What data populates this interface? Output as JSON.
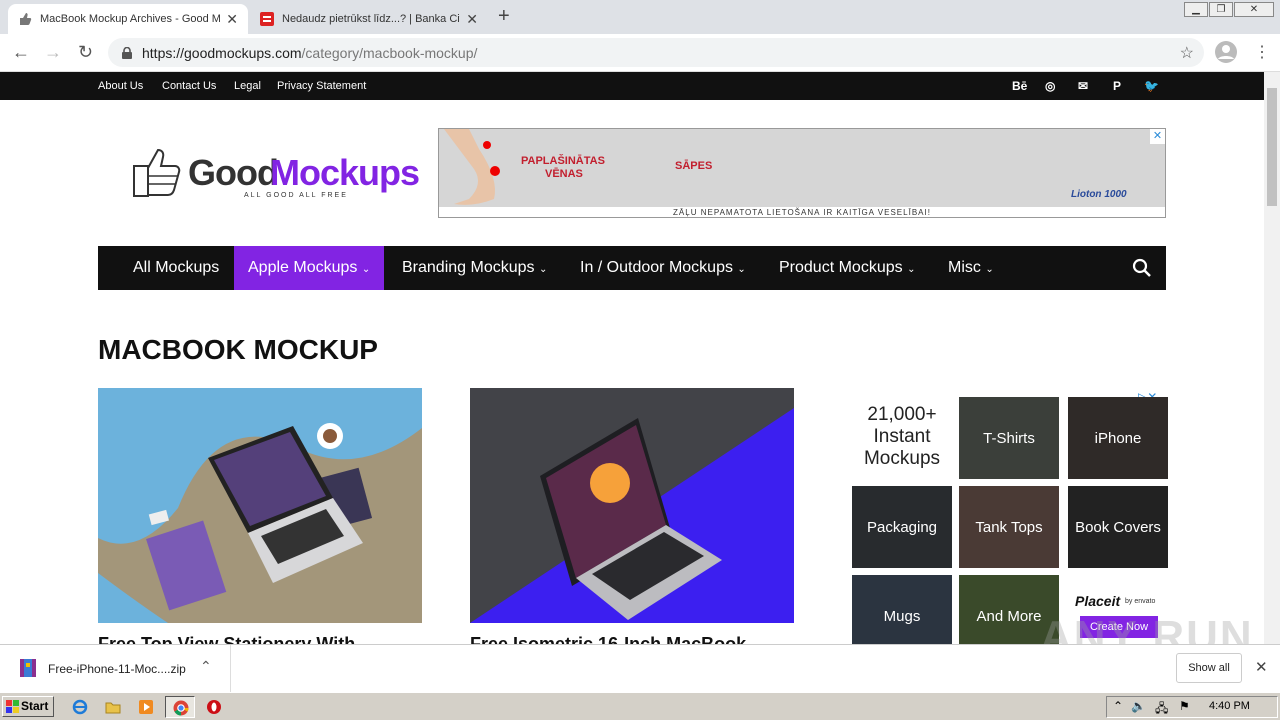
{
  "tabs": [
    {
      "title": "MacBook Mockup Archives - Good Mo",
      "close": "✕"
    },
    {
      "title": "Nedaudz pietrūkst līdz...? | Banka Cit",
      "close": "✕"
    }
  ],
  "new_tab": "+",
  "url": {
    "domain": "https://goodmockups.com",
    "path": "/category/macbook-mockup/"
  },
  "top_links": [
    "About Us",
    "Contact Us",
    "Legal",
    "Privacy Statement"
  ],
  "social": [
    "Bē",
    "◎",
    "✉",
    "P",
    "🐦"
  ],
  "logo": {
    "part1": "Good",
    "part2": "Mockups",
    "tagline": "ALL GOOD ALL FREE"
  },
  "ad": {
    "text1": "PAPLAŠINĀTAS",
    "text2": "VĒNAS",
    "text3": "SĀPES",
    "brand": "Lioton 1000",
    "footer": "ZĀĻU NEPAMATOTA LIETOŠANA IR KAITĪGA VESELĪBAI!"
  },
  "nav": [
    "All Mockups",
    "Apple Mockups",
    "Branding Mockups",
    "In / Outdoor Mockups",
    "Product Mockups",
    "Misc"
  ],
  "page_title": "MACBOOK MOCKUP",
  "posts": [
    "Free Top View Stationery With",
    "Free Isometric 16-Inch MacBook"
  ],
  "sidead": {
    "head": "21,000+ Instant Mockups",
    "tiles": [
      "T-Shirts",
      "iPhone",
      "Packaging",
      "Tank Tops",
      "Book Covers",
      "Mugs",
      "And More"
    ],
    "brand": "Placeit",
    "brand_by": "by envato",
    "cta": "Create Now"
  },
  "download": {
    "file": "Free-iPhone-11-Moc....zip",
    "show_all": "Show all"
  },
  "taskbar": {
    "start": "Start",
    "time": "4:40 PM"
  },
  "watermark": "ANY RUN"
}
